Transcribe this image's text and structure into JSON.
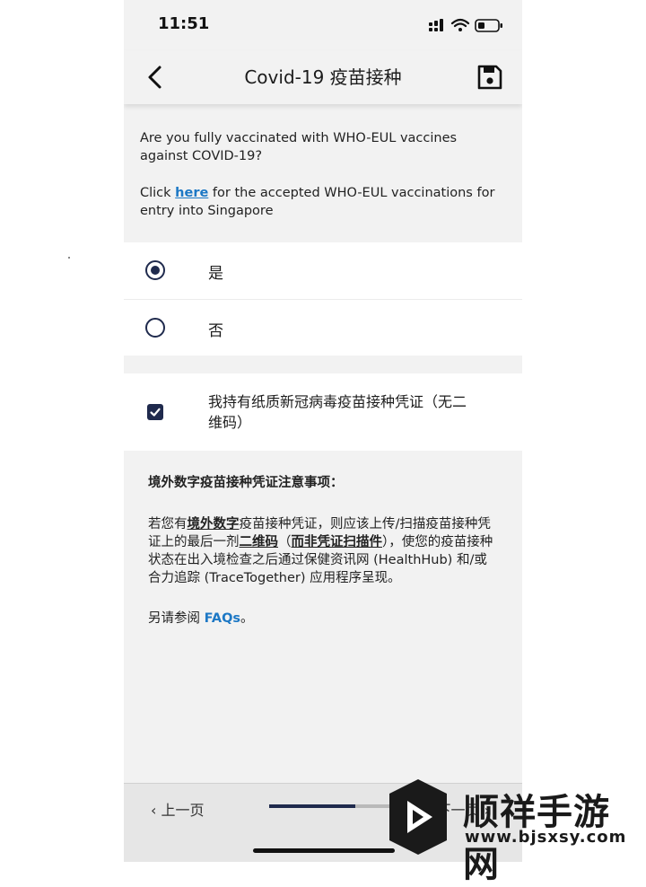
{
  "status_bar": {
    "time": "11:51"
  },
  "nav": {
    "title": "Covid-19 疫苗接种"
  },
  "intro": {
    "question": "Are you fully vaccinated with WHO-EUL vaccines against COVID-19?",
    "link_prefix": "Click ",
    "link_text": "here",
    "link_suffix": " for the accepted WHO-EUL vaccinations for entry into Singapore"
  },
  "options": [
    {
      "label": "是",
      "selected": true
    },
    {
      "label": "否",
      "selected": false
    }
  ],
  "checkbox": {
    "label": "我持有纸质新冠病毒疫苗接种凭证（无二维码）",
    "checked": true
  },
  "notice": {
    "title": "境外数字疫苗接种凭证注意事项：",
    "p1_a": "若您有",
    "p1_b": "境外数字",
    "p1_c": "疫苗接种凭证，则应该上传/扫描疫苗接种凭证上的最后一剂",
    "p1_d": "二维码",
    "p1_e": "（",
    "p1_f": "而非凭证扫描件",
    "p1_g": "），使您的疫苗接种状态在出入境检查之后通过保健资讯网 (HealthHub) 和/或 合力追踪 (TraceTogether) 应用程序呈现。",
    "see_also": "另请参阅 ",
    "faq": "FAQs",
    "period": "。"
  },
  "bottom": {
    "prev": "上一页",
    "next": "下一页",
    "progress_fraction": 0.64
  },
  "watermark": {
    "name": "顺祥手游网",
    "url": "www.bjsxsy.com"
  },
  "colors": {
    "accent_navy": "#1f2a4d",
    "link_blue": "#1d78c5",
    "background": "#f2f2f2"
  }
}
